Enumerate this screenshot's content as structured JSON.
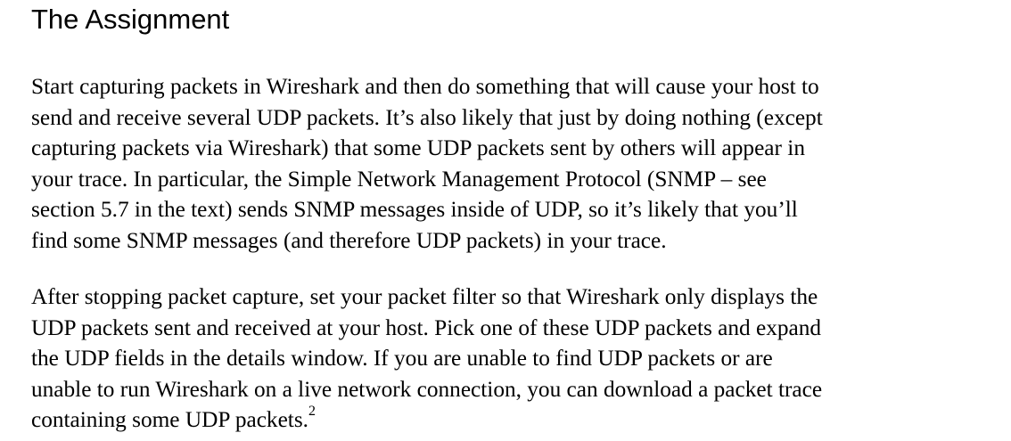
{
  "heading": "The Assignment",
  "paragraphs": [
    {
      "lines": [
        "Start capturing packets in Wireshark and then do something that will cause your host to",
        "send and receive several UDP packets. It’s also likely that just by doing nothing (except",
        "capturing packets via Wireshark) that some UDP packets sent by others will appear in",
        "your trace.  In particular, the Simple Network Management Protocol (SNMP – see",
        "section 5.7 in the text) sends SNMP messages inside of UDP, so it’s likely that you’ll",
        "find some SNMP messages (and therefore UDP packets) in your trace."
      ]
    },
    {
      "lines": [
        "After stopping packet capture, set your packet filter so that Wireshark only displays the",
        "UDP packets sent and received at your host. Pick one of these UDP packets and expand",
        "the UDP fields in the details window.  If you are unable to find UDP packets or are",
        "unable to run Wireshark on a live network connection, you can download a packet trace",
        "containing some UDP packets."
      ],
      "footnote_marker": "2"
    }
  ]
}
